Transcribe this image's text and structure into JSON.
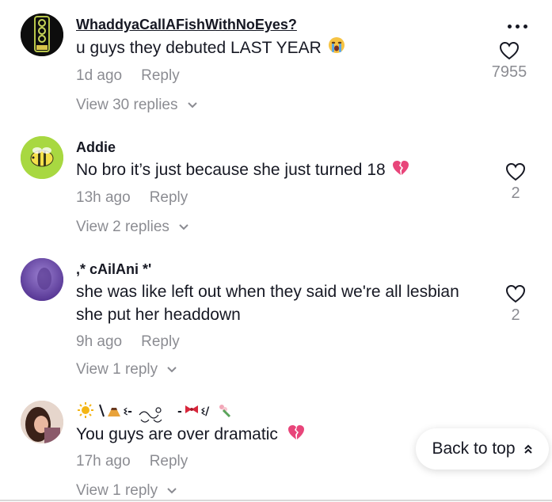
{
  "comments": [
    {
      "username": "WhaddyaCallAFishWithNoEyes?",
      "text": "u guys they debuted LAST YEAR",
      "text_emoji": "loudly-crying-emoji",
      "time": "1d ago",
      "reply_label": "Reply",
      "likes": "7955",
      "view_replies": "View 30 replies"
    },
    {
      "username": "Addie",
      "text": "No bro it’s just because she just turned 18",
      "text_emoji": "broken-heart-emoji",
      "time": "13h ago",
      "reply_label": "Reply",
      "likes": "2",
      "view_replies": "View 2 replies"
    },
    {
      "username": ",* cAilAni *'",
      "text_line1": "she was like left out when they said we're all lesbian",
      "text_line2": "she put her headdown",
      "time": "9h ago",
      "reply_label": "Reply",
      "likes": "2",
      "view_replies": "View 1 reply"
    },
    {
      "username_icons": [
        "sun-emoji",
        "backslash",
        "pudding-emoji",
        "swirl-decoration",
        "ribbon-emoji",
        "slash",
        "bouquet-emoji"
      ],
      "text": "You guys are over dramatic",
      "text_emoji": "broken-heart-emoji",
      "time": "17h ago",
      "reply_label": "Reply",
      "view_replies": "View 1 reply"
    }
  ],
  "back_to_top": {
    "label": "Back to top"
  },
  "colors": {
    "text_primary": "#161823",
    "text_secondary": "rgba(22,24,35,0.5)",
    "broken_heart": "#e8457a",
    "background": "#ffffff"
  }
}
